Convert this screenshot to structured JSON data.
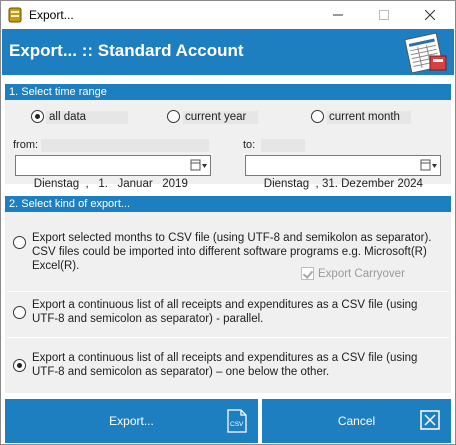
{
  "window": {
    "title": "Export..."
  },
  "header": {
    "title": "Export... :: Standard Account"
  },
  "time_range": {
    "heading": "1. Select time range",
    "options": [
      {
        "label": "all data",
        "checked": true
      },
      {
        "label": "current year",
        "checked": false
      },
      {
        "label": "current month",
        "checked": false
      }
    ],
    "from_label": "from:",
    "to_label": "to:",
    "from_value": "Dienstag  ,   1.   Januar   2019",
    "to_value": "Dienstag  , 31. Dezember 2024"
  },
  "export_kind": {
    "heading": "2. Select kind of export...",
    "options": [
      {
        "text": "Export selected months to CSV file (using UTF-8 and semikolon as separator). CSV files could be imported into different software programs e.g. Microsoft(R) Excel(R).",
        "checked": false
      },
      {
        "text": "Export a continuous list of all receipts and expenditures as a CSV file (using UTF-8 and semicolon as separator) - parallel.",
        "checked": false
      },
      {
        "text": "Export a continuous list of all receipts and expenditures as a CSV file (using UTF-8 and semicolon as separator) – one below the other.",
        "checked": true
      }
    ],
    "carryover_label": "Export Carryover",
    "carryover_checked": true
  },
  "buttons": {
    "export": "Export...",
    "cancel": "Cancel",
    "csv_icon_text": "CSV"
  },
  "colors": {
    "accent": "#1d7fbf",
    "panel": "#f0f0f0"
  }
}
